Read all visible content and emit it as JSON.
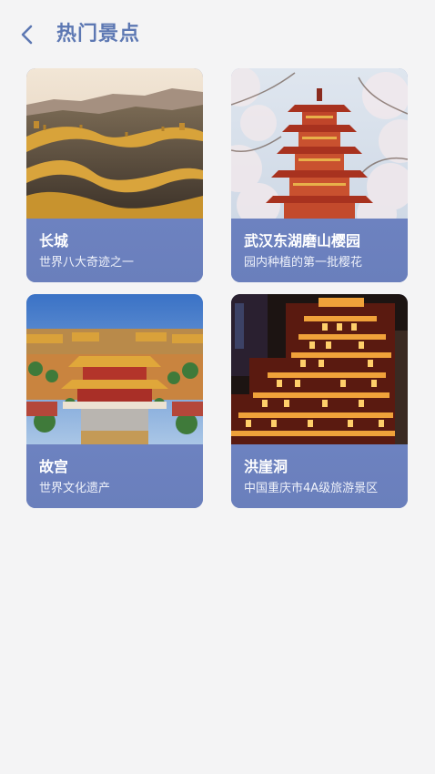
{
  "header": {
    "title": "热门景点",
    "back_icon": "chevron-left-icon"
  },
  "colors": {
    "accent": "#5d78b3",
    "card_info_bg": "#6b80be",
    "page_bg": "#f4f4f5"
  },
  "attractions": [
    {
      "name": "长城",
      "desc": "世界八大奇迹之一",
      "image": "great-wall-photo"
    },
    {
      "name": "武汉东湖磨山樱园",
      "desc": "园内种植的第一批樱花",
      "image": "cherry-blossom-pagoda-photo"
    },
    {
      "name": "故宫",
      "desc": "世界文化遗产",
      "image": "forbidden-city-photo"
    },
    {
      "name": "洪崖洞",
      "desc": "中国重庆市4A级旅游景区",
      "image": "hongyadong-night-photo"
    }
  ]
}
